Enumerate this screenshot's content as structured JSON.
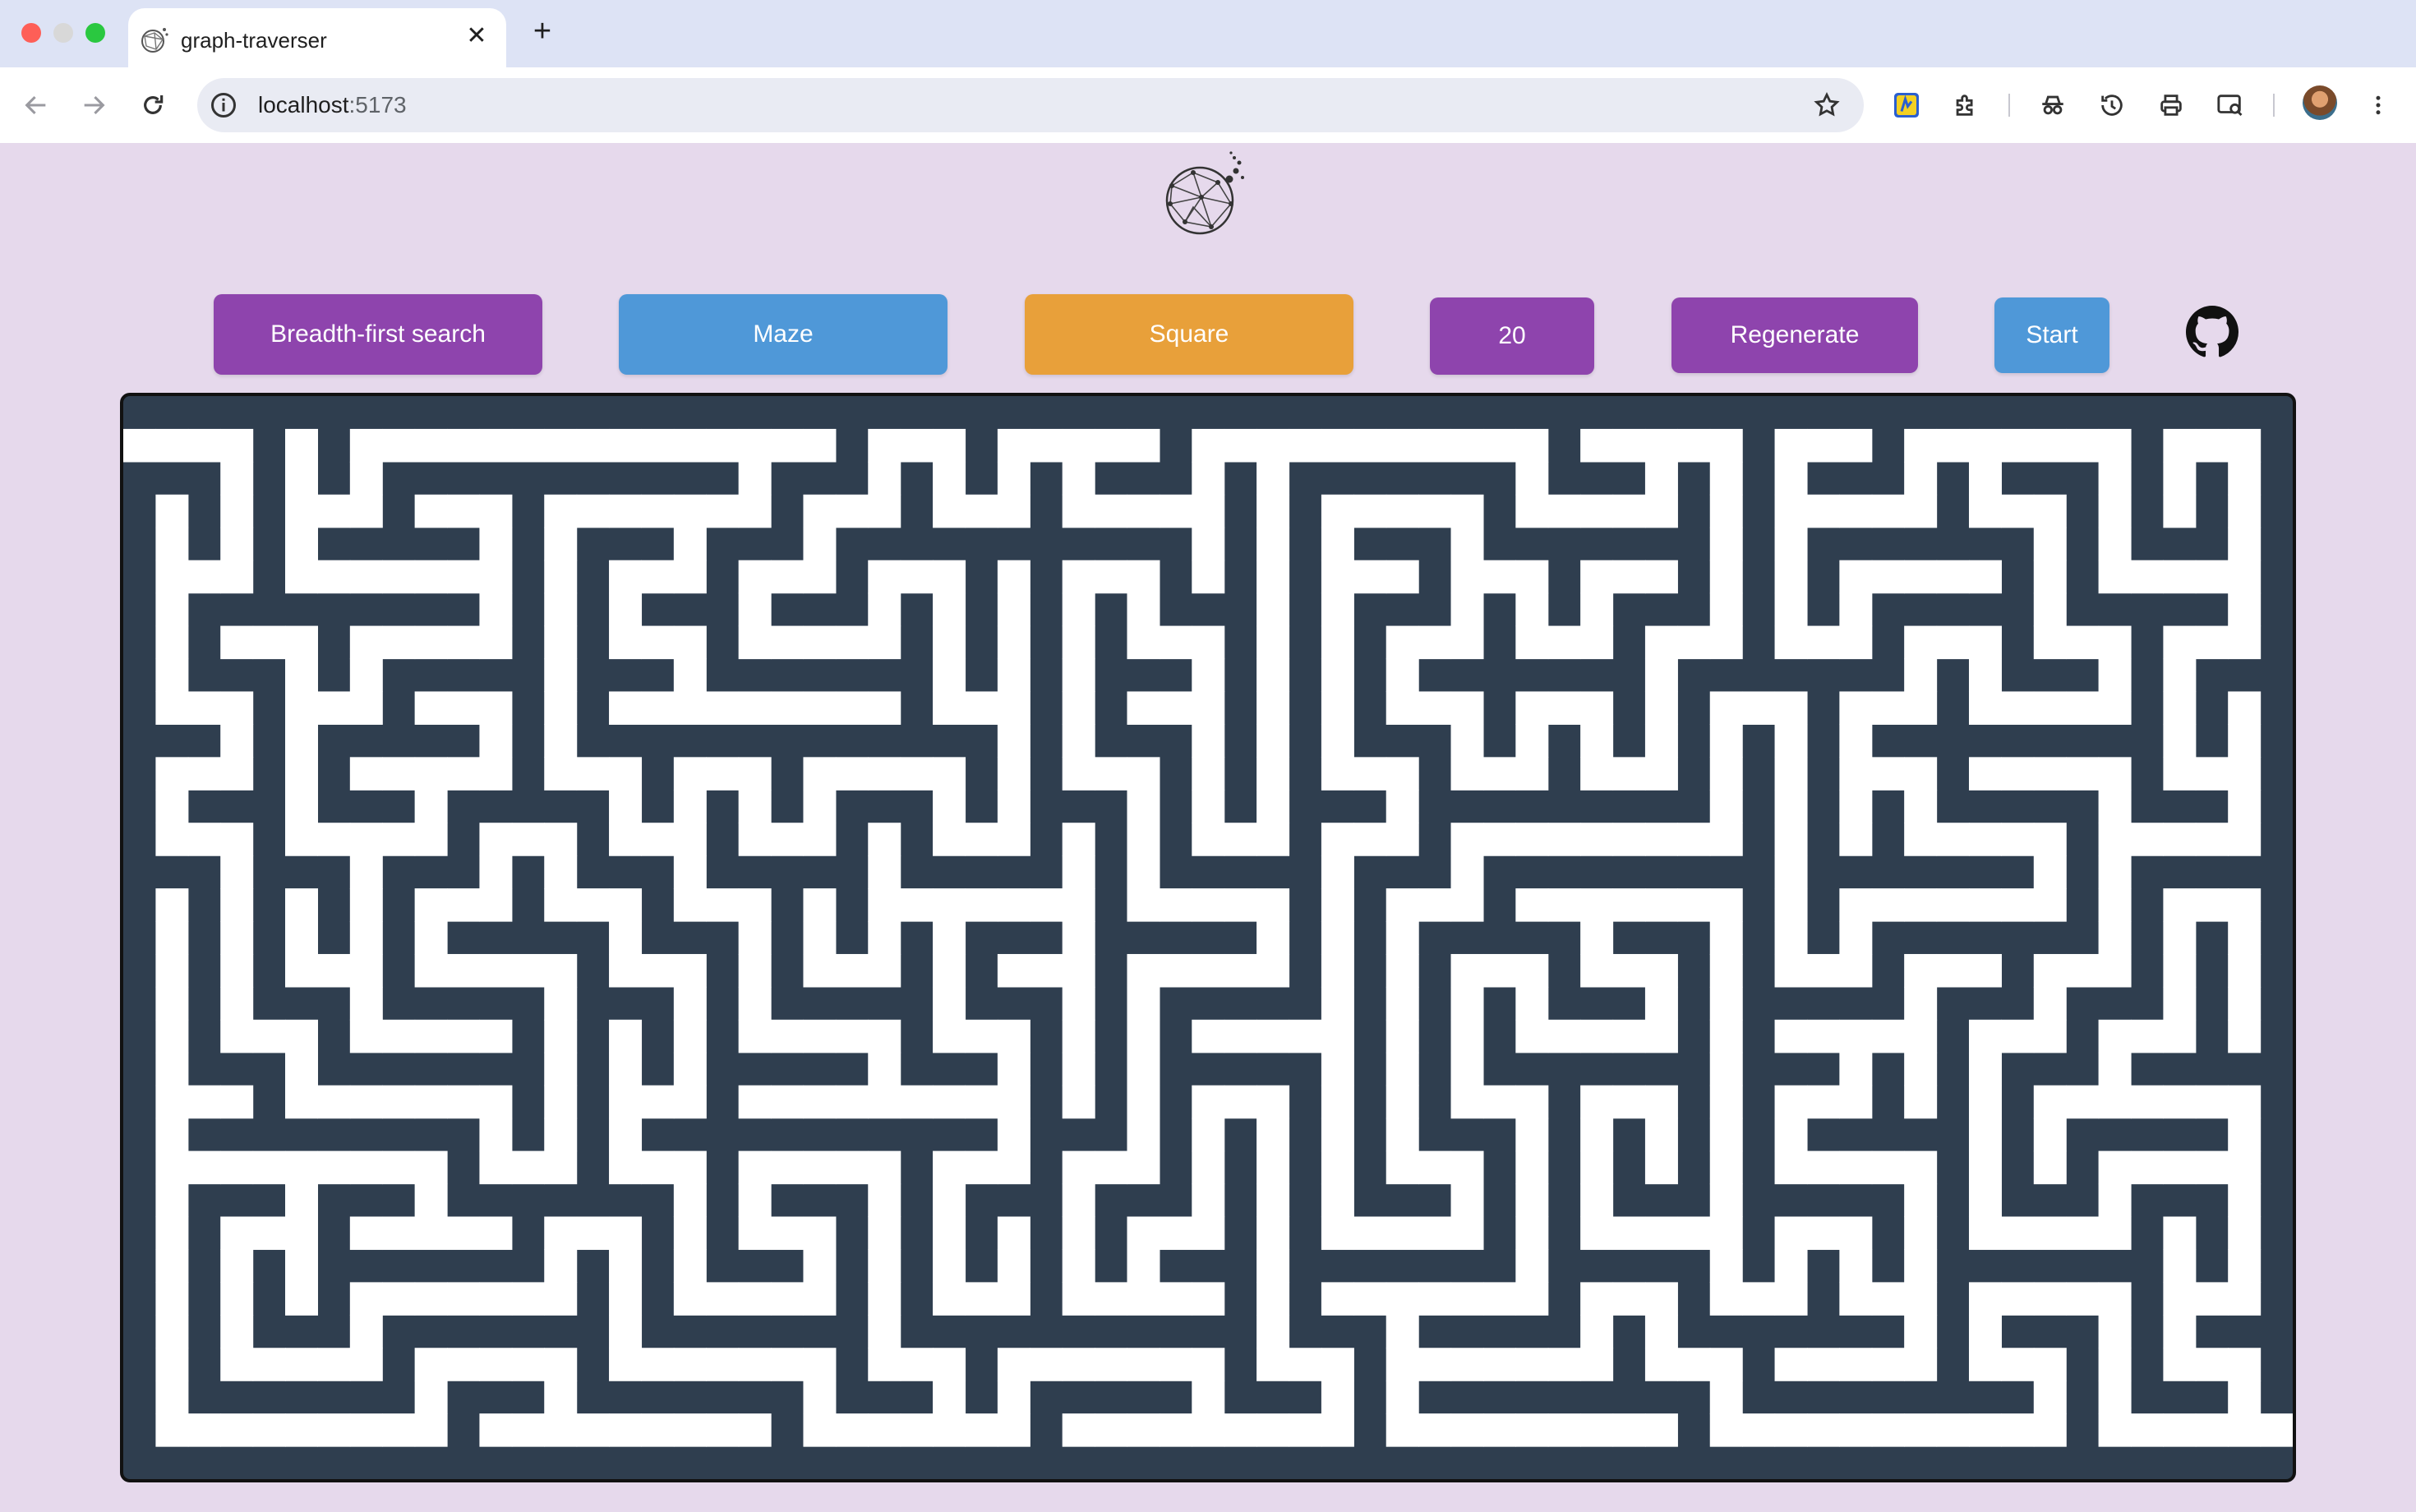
{
  "browser": {
    "tab_title": "graph-traverser",
    "close_tab_glyph": "✕",
    "new_tab_glyph": "+",
    "url_host": "localhost",
    "url_port": ":5173",
    "icons": [
      "back-arrow-icon",
      "forward-arrow-icon",
      "reload-icon",
      "site-info-icon",
      "bookmark-star-icon",
      "extension-badge-icon",
      "puzzle-extensions-icon",
      "incognito-icon",
      "history-icon",
      "print-icon",
      "search-tab-icon",
      "profile-avatar",
      "more-menu-icon"
    ]
  },
  "app": {
    "logo": "network-globe-logo",
    "controls": {
      "algorithm": "Breadth-first search",
      "graph_type": "Maze",
      "cell_shape": "Square",
      "size": "20",
      "regenerate": "Regenerate",
      "start": "Start"
    },
    "github_icon": "github-icon",
    "colors": {
      "purple": "#8e44ad",
      "blue": "#4f98d8",
      "orange": "#e8a03a",
      "wall": "#2f3e4f",
      "path": "#ffffff",
      "background": "#e6d9ec"
    },
    "maze": {
      "cell_type": "square",
      "cols": 33,
      "rows": 16,
      "wall_color": "#2f3e4f",
      "passage_color": "#ffffff"
    }
  }
}
